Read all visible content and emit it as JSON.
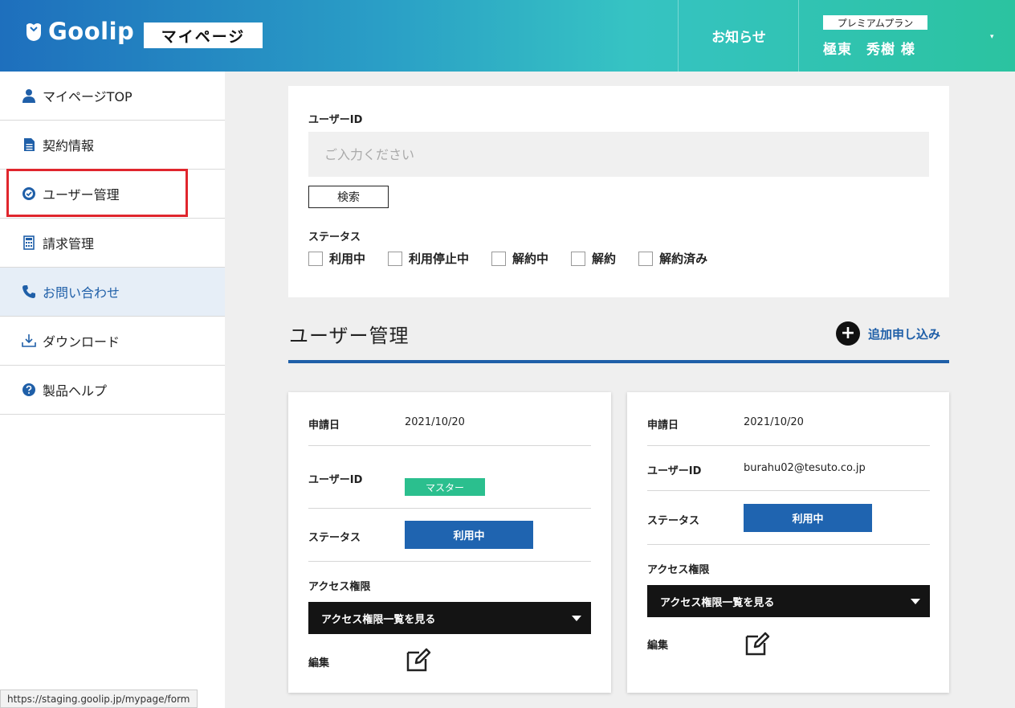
{
  "header": {
    "logo_text": "Goolip",
    "mypage_tag": "マイページ",
    "notice": "お知らせ",
    "plan": "プレミアムプラン",
    "user_name": "極東　秀樹 様",
    "caret": "▾"
  },
  "sidebar": {
    "items": [
      {
        "label": "マイページTOP",
        "icon": "user-icon"
      },
      {
        "label": "契約情報",
        "icon": "document-icon"
      },
      {
        "label": "ユーザー管理",
        "icon": "gear-check-icon"
      },
      {
        "label": "請求管理",
        "icon": "calculator-icon"
      },
      {
        "label": "お問い合わせ",
        "icon": "phone-icon"
      },
      {
        "label": "ダウンロード",
        "icon": "download-icon"
      },
      {
        "label": "製品ヘルプ",
        "icon": "help-icon"
      }
    ],
    "status_url": "https://staging.goolip.jp/mypage/form"
  },
  "search": {
    "user_id_label": "ユーザーID",
    "placeholder": "ご入力ください",
    "search_button": "検索",
    "status_label": "ステータス",
    "statuses": [
      "利用中",
      "利用停止中",
      "解約中",
      "解約",
      "解約済み"
    ]
  },
  "section": {
    "title": "ユーザー管理",
    "add_label": "追加申し込み"
  },
  "labels": {
    "date": "申請日",
    "user_id": "ユーザーID",
    "status": "ステータス",
    "access": "アクセス権限",
    "edit": "編集"
  },
  "cards": [
    {
      "date": "2021/10/20",
      "user_id_badge": "マスター",
      "status": "利用中",
      "access_dropdown": "アクセス権限一覧を見る"
    },
    {
      "date": "2021/10/20",
      "user_id": "burahu02@tesuto.co.jp",
      "status": "利用中",
      "access_dropdown": "アクセス権限一覧を見る"
    }
  ],
  "colors": {
    "accent": "#1f5fa8",
    "master_badge": "#2bbf8e",
    "highlight": "#e0262d"
  }
}
